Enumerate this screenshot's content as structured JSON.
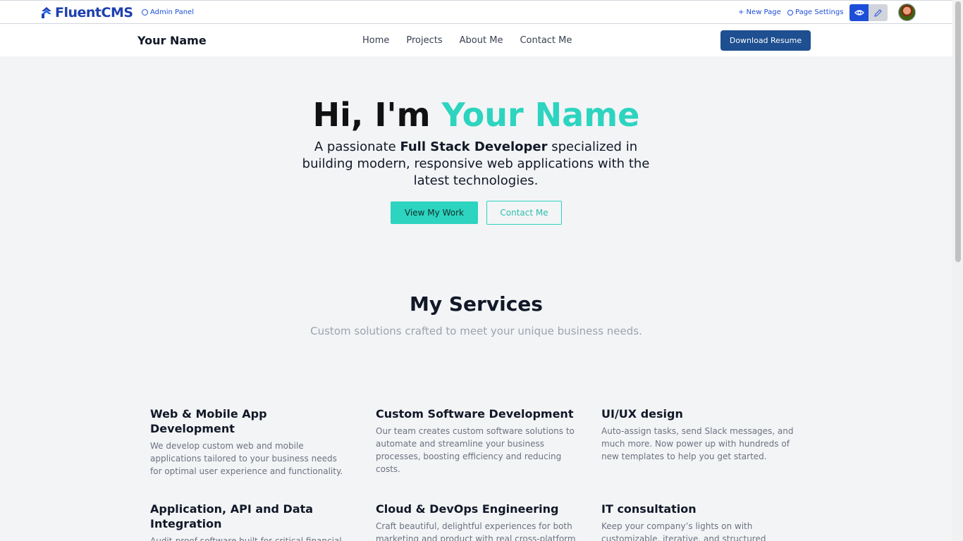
{
  "cms": {
    "logo_text": "FluentCMS",
    "admin_panel": "Admin Panel",
    "new_page": "+ New Page",
    "page_settings": "Page Settings",
    "view_mode_icon": "eye-icon",
    "edit_mode_icon": "pencil-icon"
  },
  "site": {
    "brand": "Your Name",
    "nav": [
      "Home",
      "Projects",
      "About Me",
      "Contact Me"
    ],
    "resume_button": "Download Resume"
  },
  "hero": {
    "greeting": "Hi, I'm ",
    "name": "Your Name",
    "intro_before": "A passionate ",
    "intro_bold": "Full Stack Developer",
    "intro_after": " specialized in building modern, responsive web applications with the latest technologies.",
    "primary_button": "View My Work",
    "secondary_button": "Contact Me"
  },
  "services": {
    "title": "My Services",
    "subtitle": "Custom solutions crafted to meet your unique business needs.",
    "items": [
      {
        "title": "Web & Mobile App Development",
        "text": "We develop custom web and mobile applications tailored to your business needs for optimal user experience and functionality."
      },
      {
        "title": "Custom Software Development",
        "text": "Our team creates custom software solutions to automate and streamline your business processes, boosting efficiency and reducing costs."
      },
      {
        "title": "UI/UX design",
        "text": "Auto-assign tasks, send Slack messages, and much more. Now power up with hundreds of new templates to help you get started."
      },
      {
        "title": "Application, API and Data Integration",
        "text": "Audit-proof software built for critical financial operations."
      },
      {
        "title": "Cloud & DevOps Engineering",
        "text": "Craft beautiful, delightful experiences for both marketing and product with real cross-platform compatibility."
      },
      {
        "title": "IT consultation",
        "text": "Keep your company’s lights on with customizable, iterative, and structured workflows."
      }
    ]
  },
  "colors": {
    "accent": "#2dd4bf",
    "cms_blue": "#1d4ed8",
    "resume_button": "#1e4f91"
  }
}
